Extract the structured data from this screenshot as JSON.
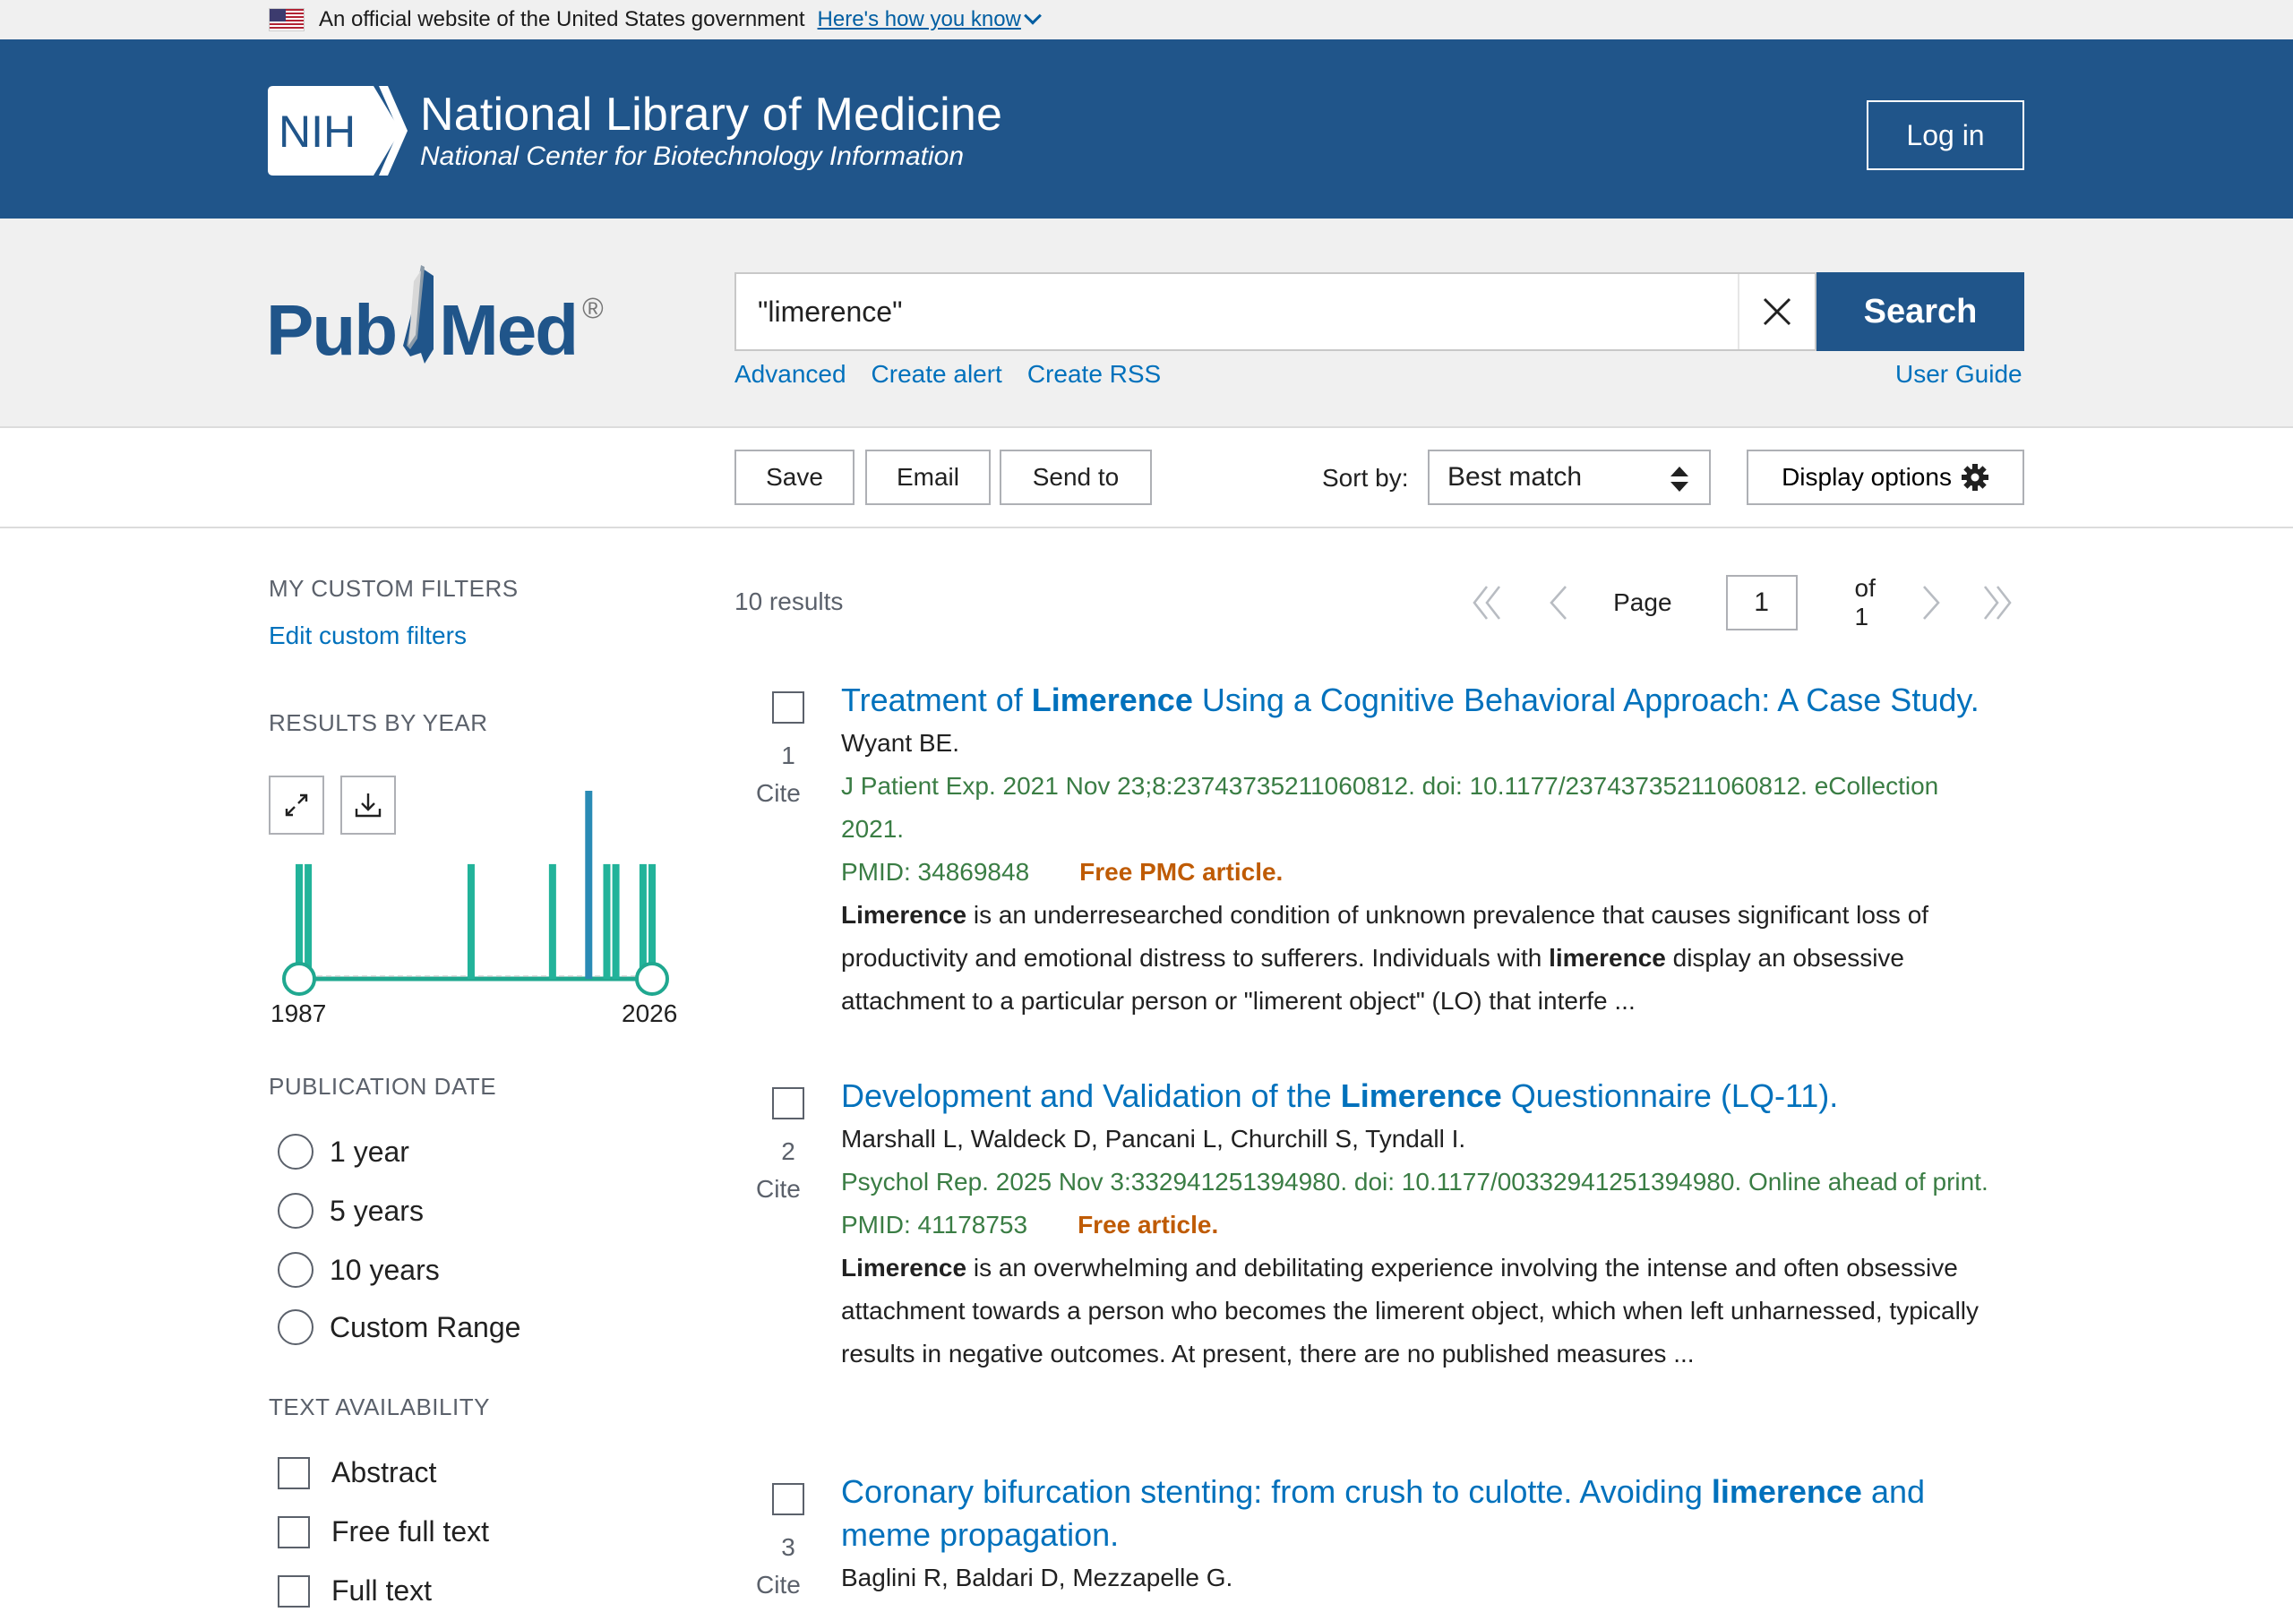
{
  "gov_banner": {
    "text": "An official website of the United States government",
    "link": "Here's how you know"
  },
  "nih": {
    "badge": "NIH",
    "title": "National Library of Medicine",
    "subtitle": "National Center for Biotechnology Information",
    "login": "Log in"
  },
  "pubmed": {
    "logo_left": "Pub",
    "logo_right": "Med",
    "logo_mark": "®"
  },
  "search": {
    "value": "\"limerence\"",
    "button": "Search",
    "links": [
      "Advanced",
      "Create alert",
      "Create RSS"
    ],
    "user_guide": "User Guide"
  },
  "toolbar": {
    "save": "Save",
    "email": "Email",
    "send_to": "Send to",
    "sort_label": "Sort by:",
    "sort_value": "Best match",
    "display_options": "Display options"
  },
  "sidebar": {
    "custom_filters_heading": "MY CUSTOM FILTERS",
    "edit_custom_filters": "Edit custom filters",
    "results_by_year_heading": "RESULTS BY YEAR",
    "year_start": "1987",
    "year_end": "2026",
    "publication_date_heading": "PUBLICATION DATE",
    "date_options": [
      "1 year",
      "5 years",
      "10 years",
      "Custom Range"
    ],
    "text_availability_heading": "TEXT AVAILABILITY",
    "text_options": [
      "Abstract",
      "Free full text",
      "Full text"
    ]
  },
  "results": {
    "count": "10 results",
    "page_label": "Page",
    "page_value": "1",
    "page_of": "of 1",
    "cite_label": "Cite",
    "items": [
      {
        "num": "1",
        "title_pre": "Treatment of ",
        "title_hl": "Limerence",
        "title_post": " Using a Cognitive Behavioral Approach: A Case Study.",
        "authors": "Wyant BE.",
        "citation": "J Patient Exp. 2021 Nov 23;8:23743735211060812. doi: 10.1177/23743735211060812. eCollection 2021.",
        "pmid": "PMID: 34869848",
        "free": "Free PMC article.",
        "snippet_hl1": "Limerence",
        "snippet_a": " is an underresearched condition of unknown prevalence that causes significant loss of productivity and emotional distress to sufferers. Individuals with ",
        "snippet_hl2": "limerence",
        "snippet_b": " display an obsessive attachment to a particular person or \"limerent object\" (LO) that interfe ..."
      },
      {
        "num": "2",
        "title_pre": "Development and Validation of the ",
        "title_hl": "Limerence",
        "title_post": " Questionnaire (LQ-11).",
        "authors": "Marshall L, Waldeck D, Pancani L, Churchill S, Tyndall I.",
        "citation": "Psychol Rep. 2025 Nov 3:332941251394980. doi: 10.1177/00332941251394980. Online ahead of print.",
        "pmid": "PMID: 41178753",
        "free": "Free article.",
        "snippet_hl1": "Limerence",
        "snippet_a": " is an overwhelming and debilitating experience involving the intense and often obsessive attachment towards a person who becomes the limerent object, which when left unharnessed, typically results in negative outcomes. At present, there are no published measures ..."
      },
      {
        "num": "3",
        "title_pre": "Coronary bifurcation stenting: from crush to culotte. Avoiding ",
        "title_hl": "limerence",
        "title_post": " and meme propagation.",
        "authors": "Baglini R, Baldari D, Mezzapelle G."
      }
    ]
  },
  "colors": {
    "nih_blue": "#20558a",
    "link_blue": "#0071bc",
    "citation_green": "#3a7d44",
    "free_orange": "#bf5b04",
    "chart_teal": "#20a890"
  },
  "chart_data": {
    "type": "bar",
    "x": [
      1987,
      1988,
      2006,
      2015,
      2019,
      2021,
      2022,
      2025,
      2026
    ],
    "values": [
      1,
      1,
      1,
      1,
      2,
      1,
      1,
      1,
      1
    ],
    "xlim": [
      1987,
      2026
    ]
  }
}
